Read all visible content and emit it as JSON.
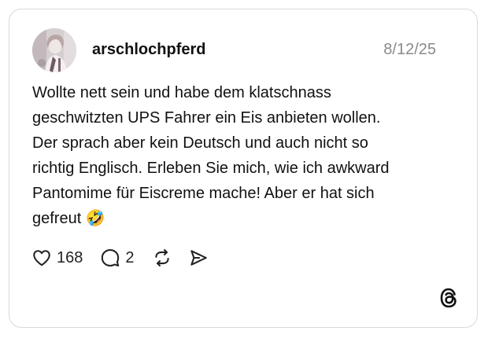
{
  "post": {
    "username": "arschlochpferd",
    "date": "8/12/25",
    "text": "Wollte nett sein und habe dem klatschnass\ngeschwitzten UPS Fahrer ein Eis anbieten wollen.\nDer sprach aber kein Deutsch und auch nicht so\nrichtig Englisch. Erleben Sie mich, wie ich awkward\nPantomime für Eiscreme mache! Aber er hat sich\ngefreut 🤣",
    "likes": "168",
    "replies": "2"
  },
  "icons": {
    "like": "heart-icon",
    "reply": "comment-bubble-icon",
    "repost": "repost-icon",
    "share": "send-icon",
    "brand": "threads-logo"
  },
  "colors": {
    "text": "#111111",
    "muted": "#8a8a8a",
    "border": "#d9d9d9"
  }
}
